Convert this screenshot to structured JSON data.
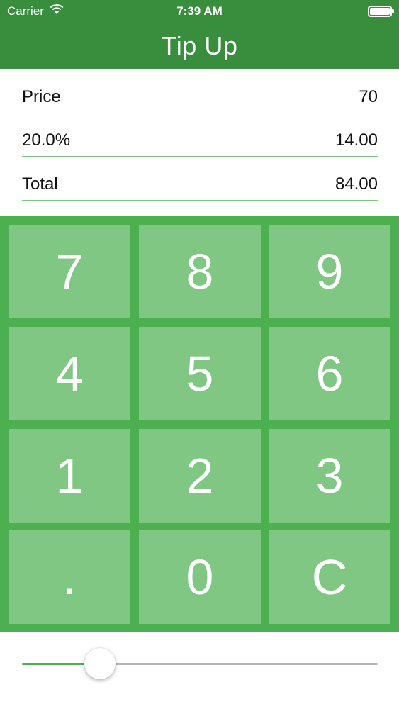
{
  "status": {
    "carrier": "Carrier",
    "time": "7:39 AM"
  },
  "nav": {
    "title": "Tip Up"
  },
  "rows": [
    {
      "label": "Price",
      "value": "70"
    },
    {
      "label": "20.0%",
      "value": "14.00"
    },
    {
      "label": "Total",
      "value": "84.00"
    }
  ],
  "keypad": {
    "keys": [
      "7",
      "8",
      "9",
      "4",
      "5",
      "6",
      "1",
      "2",
      "3",
      ".",
      "0",
      "C"
    ]
  },
  "slider": {
    "level": 0.22
  },
  "colors": {
    "nav_bar": "#388e3c",
    "keypad_bg": "#4caf50",
    "key_bg": "#81c784",
    "divider": "#7cc47f",
    "slider_fill": "#4caf50"
  },
  "icons": {
    "wifi": "wifi-icon",
    "battery": "battery-icon"
  }
}
